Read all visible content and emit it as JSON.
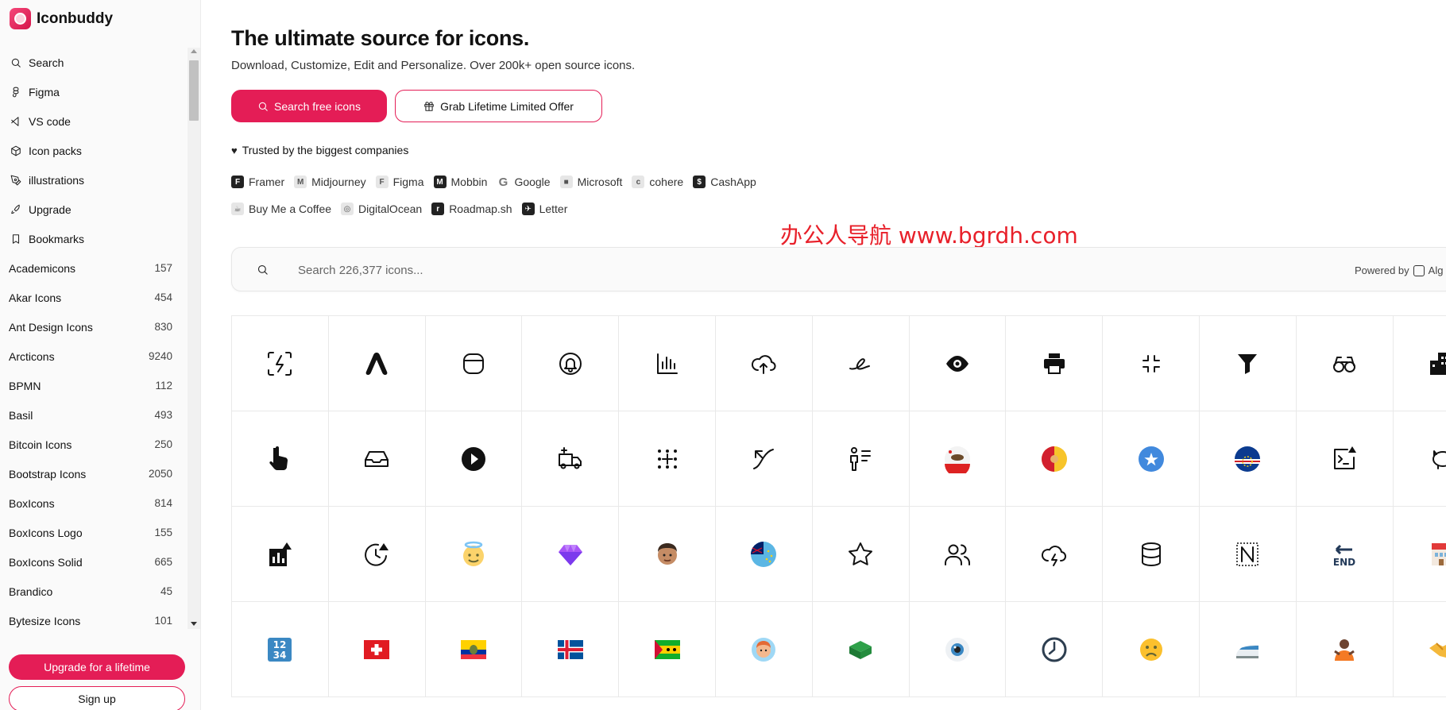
{
  "app": {
    "name": "Iconbuddy"
  },
  "sidebar": {
    "nav": [
      {
        "label": "Search",
        "icon": "search-icon"
      },
      {
        "label": "Figma",
        "icon": "figma-icon"
      },
      {
        "label": "VS code",
        "icon": "vscode-icon"
      },
      {
        "label": "Icon packs",
        "icon": "package-icon"
      },
      {
        "label": "illustrations",
        "icon": "pen-tool-icon"
      },
      {
        "label": "Upgrade",
        "icon": "rocket-icon"
      },
      {
        "label": "Bookmarks",
        "icon": "bookmark-icon"
      }
    ],
    "packs": [
      {
        "name": "Academicons",
        "count": "157"
      },
      {
        "name": "Akar Icons",
        "count": "454"
      },
      {
        "name": "Ant Design Icons",
        "count": "830"
      },
      {
        "name": "Arcticons",
        "count": "9240"
      },
      {
        "name": "BPMN",
        "count": "112"
      },
      {
        "name": "Basil",
        "count": "493"
      },
      {
        "name": "Bitcoin Icons",
        "count": "250"
      },
      {
        "name": "Bootstrap Icons",
        "count": "2050"
      },
      {
        "name": "BoxIcons",
        "count": "814"
      },
      {
        "name": "BoxIcons Logo",
        "count": "155"
      },
      {
        "name": "BoxIcons Solid",
        "count": "665"
      },
      {
        "name": "Brandico",
        "count": "45"
      },
      {
        "name": "Bytesize Icons",
        "count": "101"
      }
    ],
    "upgrade_label": "Upgrade for a lifetime",
    "signup_label": "Sign up"
  },
  "hero": {
    "title": "The ultimate source for icons.",
    "subtitle": "Download, Customize, Edit and Personalize. Over 200k+ open source icons.",
    "primary_button": "Search free icons",
    "secondary_button": "Grab Lifetime Limited Offer"
  },
  "trusted": {
    "label": "Trusted by the biggest companies",
    "companies": [
      {
        "name": "Framer",
        "logo": "F",
        "style": "dark"
      },
      {
        "name": "Midjourney",
        "logo": "M",
        "style": "light"
      },
      {
        "name": "Figma",
        "logo": "F",
        "style": "light"
      },
      {
        "name": "Mobbin",
        "logo": "M",
        "style": "dark"
      },
      {
        "name": "Google",
        "logo": "G",
        "style": "google"
      },
      {
        "name": "Microsoft",
        "logo": "■",
        "style": "light"
      },
      {
        "name": "cohere",
        "logo": "c",
        "style": "light"
      },
      {
        "name": "CashApp",
        "logo": "$",
        "style": "dark"
      },
      {
        "name": "Buy Me a Coffee",
        "logo": "☕",
        "style": "light"
      },
      {
        "name": "DigitalOcean",
        "logo": "◎",
        "style": "light"
      },
      {
        "name": "Roadmap.sh",
        "logo": "r",
        "style": "dark"
      },
      {
        "name": "Letter",
        "logo": "✈",
        "style": "dark"
      }
    ]
  },
  "watermark": "办公人导航  www.bgrdh.com",
  "search": {
    "placeholder": "Search 226,377 icons...",
    "powered_by": "Powered by",
    "powered_by_brand": "Alg"
  },
  "icons": [
    "lightning-scan-icon",
    "arc-logo-icon",
    "rounded-square-icon",
    "bell-circle-icon",
    "bar-chart-icon",
    "cloud-upload-icon",
    "alibaba-logo-icon",
    "eye-icon",
    "printer-icon",
    "minimize-arrows-icon",
    "filter-icon",
    "binoculars-icon",
    "buildings-icon",
    "hand-pointing-icon",
    "inbox-tray-icon",
    "play-circle-icon",
    "truck-plus-icon",
    "dots-grid-icon",
    "arrow-curve-icon",
    "person-list-icon",
    "california-flag-icon",
    "sicily-flag-icon",
    "somalia-flag-icon",
    "cape-verde-flag-icon",
    "terminal-warning-icon",
    "piggy-bank-icon",
    "chart-warning-icon",
    "moon-clock-warning-icon",
    "angel-face-emoji-icon",
    "gem-emoji-icon",
    "man-face-emoji-icon",
    "tuvalu-flag-icon",
    "star-outline-icon",
    "users-icon",
    "thunder-cloud-icon",
    "database-icon",
    "notion-n-icon",
    "end-arrow-emoji-icon",
    "calendar-building-icon",
    "keycap-1234-emoji-icon",
    "switzerland-flag-icon",
    "ecuador-flag-icon",
    "iceland-flag-icon",
    "sao-tome-flag-icon",
    "person-face-emoji-icon",
    "green-block-icon",
    "eye-emoji-icon",
    "clock-icon",
    "frowning-face-emoji-icon",
    "train-emoji-icon",
    "person-shrug-emoji-icon",
    "handshake-emoji-icon"
  ]
}
